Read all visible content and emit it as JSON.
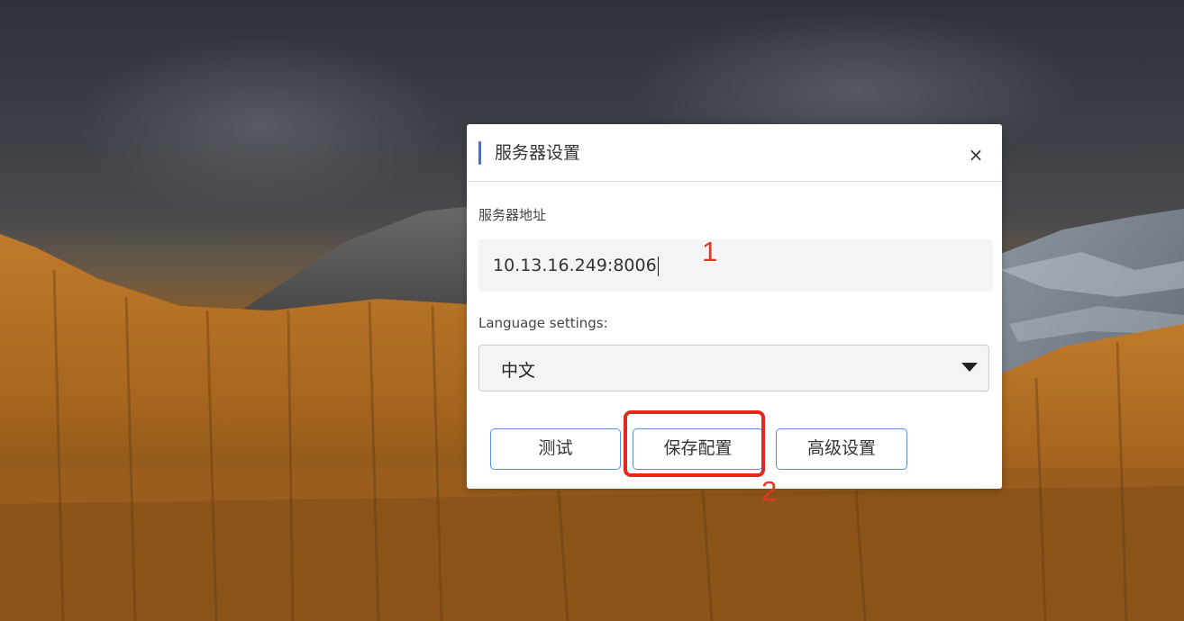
{
  "dialog": {
    "title": "服务器设置",
    "close_icon": "×",
    "server_address_label": "服务器地址",
    "server_address_value": "10.13.16.249:8006",
    "language_label": "Language settings:",
    "language_selected": "中文",
    "buttons": {
      "test": "测试",
      "save": "保存配置",
      "advanced": "高级设置"
    }
  },
  "annotations": {
    "step1": "1",
    "step2": "2"
  },
  "colors": {
    "accent": "#3b73e6",
    "button_border": "#5b8ee6",
    "annotation": "#e8261a"
  }
}
